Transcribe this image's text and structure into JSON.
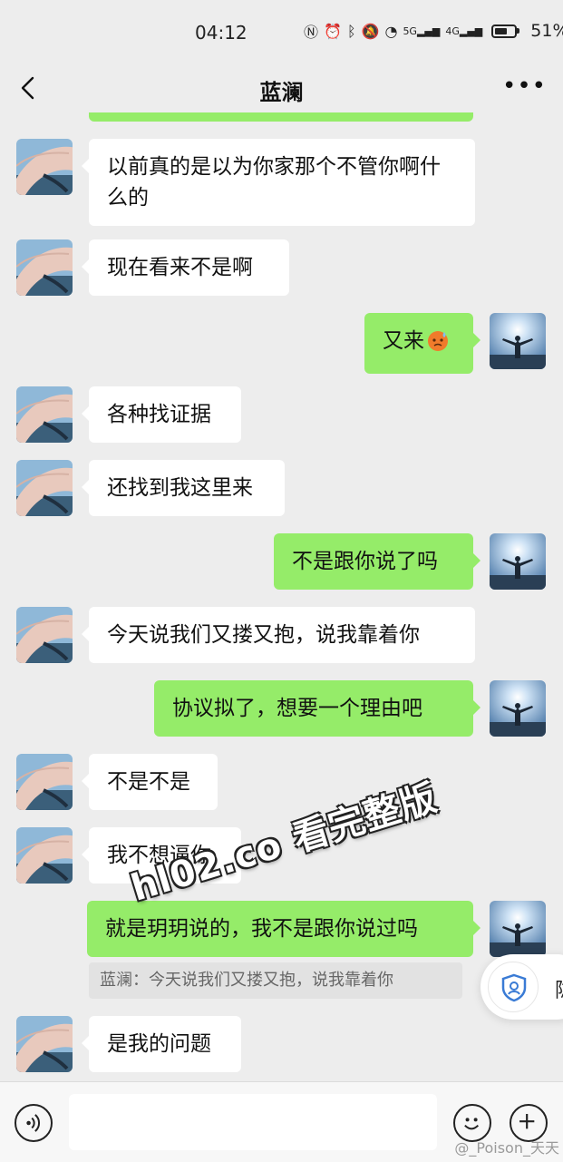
{
  "status": {
    "time": "04:12",
    "battery": "51%",
    "net1": "5G",
    "net2": "4G"
  },
  "header": {
    "title": "蓝澜"
  },
  "messages": [
    {
      "dir": "in",
      "text": "以前真的是以为你家那个不管你啊什么的"
    },
    {
      "dir": "in",
      "text": "现在看来不是啊"
    },
    {
      "dir": "out",
      "text": "又来"
    },
    {
      "dir": "in",
      "text": "各种找证据"
    },
    {
      "dir": "in",
      "text": "还找到我这里来"
    },
    {
      "dir": "out",
      "text": "不是跟你说了吗"
    },
    {
      "dir": "in",
      "text": "今天说我们又搂又抱，说我靠着你"
    },
    {
      "dir": "out",
      "text": "协议拟了，想要一个理由吧"
    },
    {
      "dir": "in",
      "text": "不是不是"
    },
    {
      "dir": "in",
      "text": "我不想逼你"
    },
    {
      "dir": "out",
      "text": "就是玥玥说的，我不是跟你说过吗"
    },
    {
      "dir": "in",
      "text": "是我的问题"
    }
  ],
  "quote": "蓝澜：今天说我们又搂又抱，说我靠着你",
  "watermark": "hl02.co 看完整版",
  "float_label": "隐",
  "weibo_mark": "@_Poison_天天",
  "icons": [
    "back-icon",
    "more-icon",
    "voice-icon",
    "emoji-icon",
    "plus-icon",
    "shield-icon",
    "sweat-emoji-icon"
  ]
}
